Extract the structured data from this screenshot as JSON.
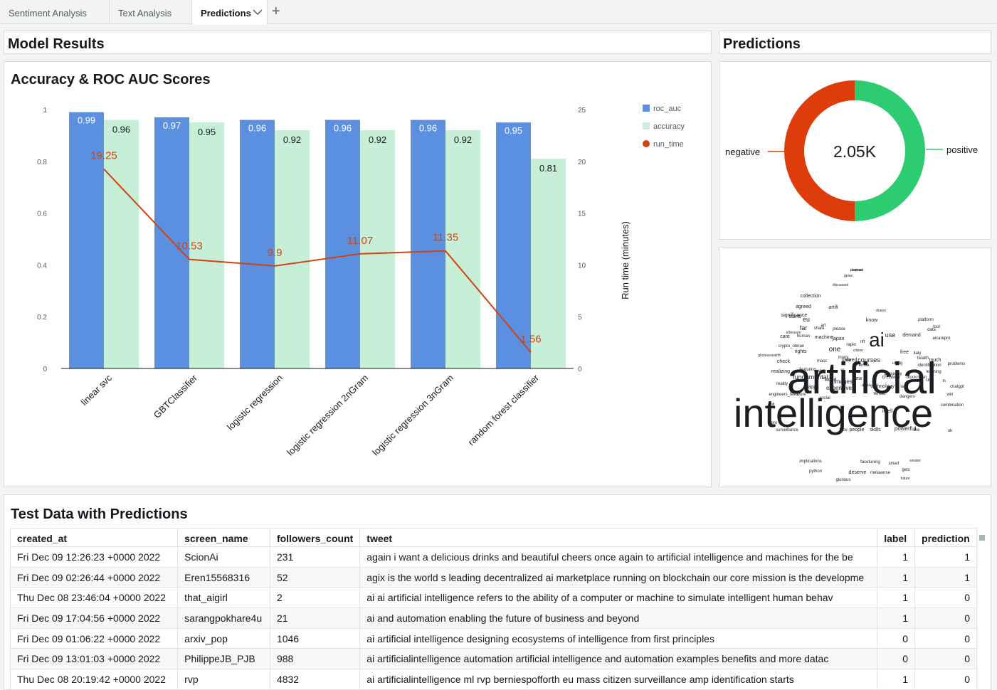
{
  "tabs": [
    {
      "label": "Sentiment Analysis"
    },
    {
      "label": "Text Analysis"
    },
    {
      "label": "Predictions"
    }
  ],
  "panels": {
    "model_results_title": "Model Results",
    "predictions_title": "Predictions",
    "chart_title": "Accuracy & ROC AUC Scores",
    "table_title": "Test Data with Predictions"
  },
  "chart_data": [
    {
      "type": "bar",
      "title": "Accuracy & ROC AUC Scores",
      "categories": [
        "linear svc",
        "GBTClassifier",
        "logistic regression",
        "logistic regression 2nGram",
        "logistic regression 3nGram",
        "random forest classifier"
      ],
      "series": [
        {
          "name": "roc_auc",
          "type": "bar",
          "axis": "left",
          "color": "#5b8fe0",
          "values": [
            0.99,
            0.97,
            0.96,
            0.96,
            0.96,
            0.95
          ]
        },
        {
          "name": "accuracy",
          "type": "bar",
          "axis": "left",
          "color": "#c7efd8",
          "values": [
            0.96,
            0.95,
            0.92,
            0.92,
            0.92,
            0.81
          ]
        },
        {
          "name": "run_time",
          "type": "line",
          "axis": "right",
          "color": "#d3430f",
          "values": [
            19.25,
            10.53,
            9.9,
            11.07,
            11.35,
            1.56
          ]
        }
      ],
      "ylim": [
        0,
        1
      ],
      "yticks": [
        "0",
        "0.2",
        "0.4",
        "0.6",
        "0.8",
        "1"
      ],
      "y2lim": [
        0,
        25
      ],
      "y2ticks": [
        "0",
        "5",
        "10",
        "15",
        "20",
        "25"
      ],
      "y2label": "Run time (minutes)",
      "legend_position": "top-right",
      "grid": false
    },
    {
      "type": "pie",
      "subtype": "donut",
      "center_label": "2.05K",
      "categories": [
        "negative",
        "positive"
      ],
      "values": [
        50,
        50
      ],
      "colors": [
        "#de3c0b",
        "#2ecc71"
      ]
    }
  ],
  "wordcloud": {
    "big": [
      {
        "text": "artificial"
      },
      {
        "text": "intelligence"
      },
      {
        "text": "ai"
      }
    ],
    "small": [
      {
        "text": "abstract"
      },
      {
        "text": "gpiax"
      },
      {
        "text": "discussed"
      },
      {
        "text": "collection"
      },
      {
        "text": "artifi"
      },
      {
        "text": "agreed"
      },
      {
        "text": "doesn"
      },
      {
        "text": "starts"
      },
      {
        "text": "significance"
      },
      {
        "text": "know"
      },
      {
        "text": "eu"
      },
      {
        "text": "share"
      },
      {
        "text": "platform"
      },
      {
        "text": "far"
      },
      {
        "text": "machine"
      },
      {
        "text": "japan"
      },
      {
        "text": "nft"
      },
      {
        "text": "data"
      },
      {
        "text": "care"
      },
      {
        "text": "crypto_obrian"
      },
      {
        "text": "art"
      },
      {
        "text": "aicarepro"
      },
      {
        "text": "rapid"
      },
      {
        "text": "lensa"
      },
      {
        "text": "use"
      },
      {
        "text": "demand"
      },
      {
        "text": "please"
      },
      {
        "text": "tool"
      },
      {
        "text": "human"
      },
      {
        "text": "ethereum"
      },
      {
        "text": "one"
      },
      {
        "text": "free"
      },
      {
        "text": "citizen"
      },
      {
        "text": "gloriousrealnft"
      },
      {
        "text": "rights"
      },
      {
        "text": "many"
      },
      {
        "text": "courses"
      },
      {
        "text": "italy"
      },
      {
        "text": "enter"
      },
      {
        "text": "wired"
      },
      {
        "text": "health"
      },
      {
        "text": "much"
      },
      {
        "text": "check"
      },
      {
        "text": "mass"
      },
      {
        "text": "using"
      },
      {
        "text": "problems"
      },
      {
        "text": "identification"
      },
      {
        "text": "featuring"
      },
      {
        "text": "wl"
      },
      {
        "text": "rn"
      },
      {
        "text": "giveaway"
      },
      {
        "text": "learning"
      },
      {
        "text": "realizing"
      },
      {
        "text": "fundamental"
      },
      {
        "text": "new"
      },
      {
        "text": "creation"
      },
      {
        "text": "blockchain"
      },
      {
        "text": "us"
      },
      {
        "text": "world"
      },
      {
        "text": "images"
      },
      {
        "text": "th"
      },
      {
        "text": "reality"
      },
      {
        "text": "uses"
      },
      {
        "text": "last"
      },
      {
        "text": "apps"
      },
      {
        "text": "expensive"
      },
      {
        "text": "technology"
      },
      {
        "text": "chatgpt"
      },
      {
        "text": "engineers_feed"
      },
      {
        "text": "work"
      },
      {
        "text": "wrote"
      },
      {
        "text": "dangers"
      },
      {
        "text": "win"
      },
      {
        "text": "social"
      },
      {
        "text": "cinft"
      },
      {
        "text": "combination"
      },
      {
        "text": "intell"
      },
      {
        "text": "pro"
      },
      {
        "text": "surveillance"
      },
      {
        "text": "face"
      },
      {
        "text": "people"
      },
      {
        "text": "skills"
      },
      {
        "text": "powerful"
      },
      {
        "text": "like"
      },
      {
        "text": "uk"
      },
      {
        "text": "implications"
      },
      {
        "text": "facetuning"
      },
      {
        "text": "smart"
      },
      {
        "text": "sinister"
      },
      {
        "text": "python"
      },
      {
        "text": "deserve"
      },
      {
        "text": "metaverse"
      },
      {
        "text": "gets"
      },
      {
        "text": "future"
      },
      {
        "text": "glorious"
      },
      {
        "text": "purpose"
      }
    ]
  },
  "table": {
    "columns": [
      "created_at",
      "screen_name",
      "followers_count",
      "tweet",
      "label",
      "prediction"
    ],
    "rows": [
      [
        "Fri Dec 09 12:26:23 +0000 2022",
        "ScionAi",
        "231",
        "again i want a delicious drinks and beautiful cheers once again to artificial intelligence and machines for the be",
        "1",
        "1"
      ],
      [
        "Fri Dec 09 02:26:44 +0000 2022",
        "Eren15568316",
        "52",
        "agix is the world s leading decentralized ai marketplace running on blockchain our core mission is the developme",
        "1",
        "1"
      ],
      [
        "Thu Dec 08 23:46:04 +0000 2022",
        "that_aigirl",
        "2",
        "ai ai artificial intelligence refers to the ability of a computer or machine to simulate intelligent human behav",
        "1",
        "0"
      ],
      [
        "Fri Dec 09 17:04:56 +0000 2022",
        "sarangpokhare4u",
        "21",
        "ai and automation enabling the future of business and beyond",
        "1",
        "0"
      ],
      [
        "Fri Dec 09 01:06:22 +0000 2022",
        "arxiv_pop",
        "1046",
        "ai artificial intelligence designing ecosystems of intelligence from first principles",
        "0",
        "0"
      ],
      [
        "Fri Dec 09 13:01:03 +0000 2022",
        "PhilippeJB_PJB",
        "988",
        "ai artificialintelligence automation artificial intelligence and automation examples benefits and more datac",
        "0",
        "0"
      ],
      [
        "Thu Dec 08 20:19:42 +0000 2022",
        "rvp",
        "4832",
        "ai artificialintelligence ml rvp berniespofforth eu mass citizen surveillance amp identification starts",
        "1",
        "0"
      ]
    ]
  }
}
